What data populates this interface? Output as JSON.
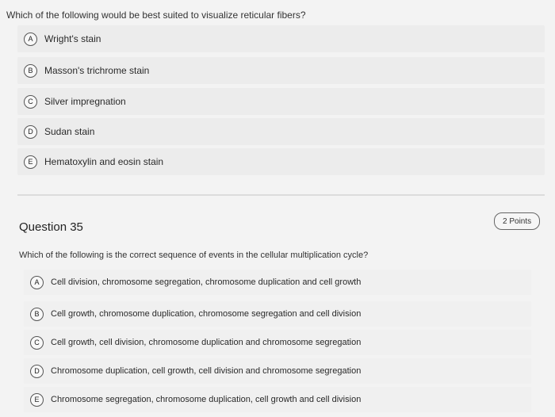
{
  "question1": {
    "text": "Which of the following would be best suited to visualize reticular fibers?",
    "options": [
      {
        "letter": "A",
        "label": "Wright's stain"
      },
      {
        "letter": "B",
        "label": "Masson's trichrome stain"
      },
      {
        "letter": "C",
        "label": "Silver impregnation"
      },
      {
        "letter": "D",
        "label": "Sudan stain"
      },
      {
        "letter": "E",
        "label": "Hematoxylin and eosin stain"
      }
    ]
  },
  "question2": {
    "title": "Question 35",
    "points": "2 Points",
    "text": "Which of the following is the correct sequence of events in the cellular multiplication cycle?",
    "options": [
      {
        "letter": "A",
        "label": "Cell division, chromosome segregation, chromosome duplication and cell growth"
      },
      {
        "letter": "B",
        "label": "Cell growth, chromosome duplication, chromosome segregation and cell division"
      },
      {
        "letter": "C",
        "label": "Cell growth, cell division, chromosome duplication and chromosome segregation"
      },
      {
        "letter": "D",
        "label": "Chromosome duplication, cell growth, cell division and chromosome segregation"
      },
      {
        "letter": "E",
        "label": "Chromosome segregation, chromosome duplication, cell growth and cell division"
      }
    ]
  }
}
